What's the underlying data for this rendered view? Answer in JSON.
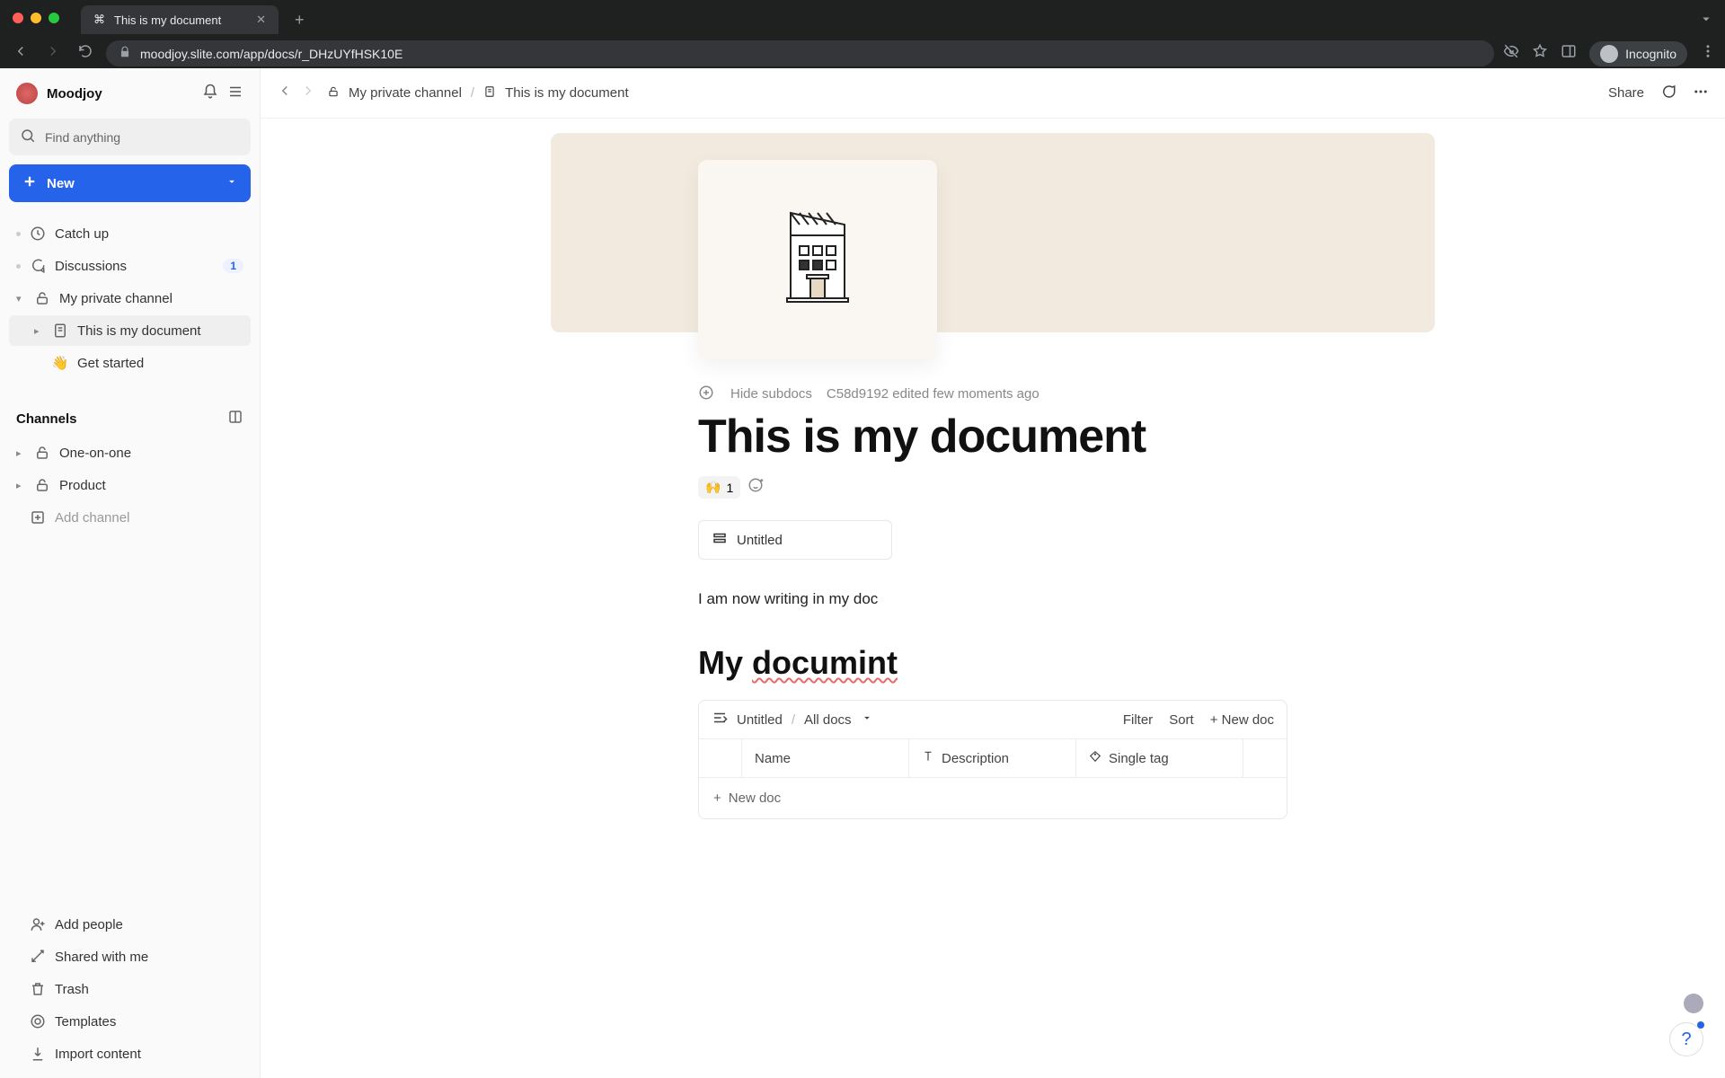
{
  "browser": {
    "tab_title": "This is my document",
    "url": "moodjoy.slite.com/app/docs/r_DHzUYfHSK10E",
    "incognito_label": "Incognito"
  },
  "workspace": {
    "name": "Moodjoy"
  },
  "search": {
    "placeholder": "Find anything"
  },
  "new_button": "New",
  "sidebar": {
    "catch_up": "Catch up",
    "discussions": "Discussions",
    "discussions_badge": "1",
    "private_channel": "My private channel",
    "doc_this": "This is my document",
    "doc_getstarted": "Get started",
    "channels_header": "Channels",
    "one_on_one": "One-on-one",
    "product": "Product",
    "add_channel": "Add channel",
    "add_people": "Add people",
    "shared": "Shared with me",
    "trash": "Trash",
    "templates": "Templates",
    "import": "Import content"
  },
  "breadcrumb": {
    "channel": "My private channel",
    "doc": "This is my document"
  },
  "topbar": {
    "share": "Share"
  },
  "doc": {
    "hide_subdocs": "Hide subdocs",
    "edited_by": "C58d9192 edited few moments ago",
    "title": "This is my document",
    "reaction_emoji": "🙌",
    "reaction_count": "1",
    "subdoc_title": "Untitled",
    "body": "I am now writing in my doc",
    "h2_pre": "My ",
    "h2_typo": "documint"
  },
  "table": {
    "source": "Untitled",
    "scope": "All docs",
    "filter": "Filter",
    "sort": "Sort",
    "new_doc": "New doc",
    "col_name": "Name",
    "col_desc": "Description",
    "col_tag": "Single tag",
    "footer_new": "New doc"
  }
}
